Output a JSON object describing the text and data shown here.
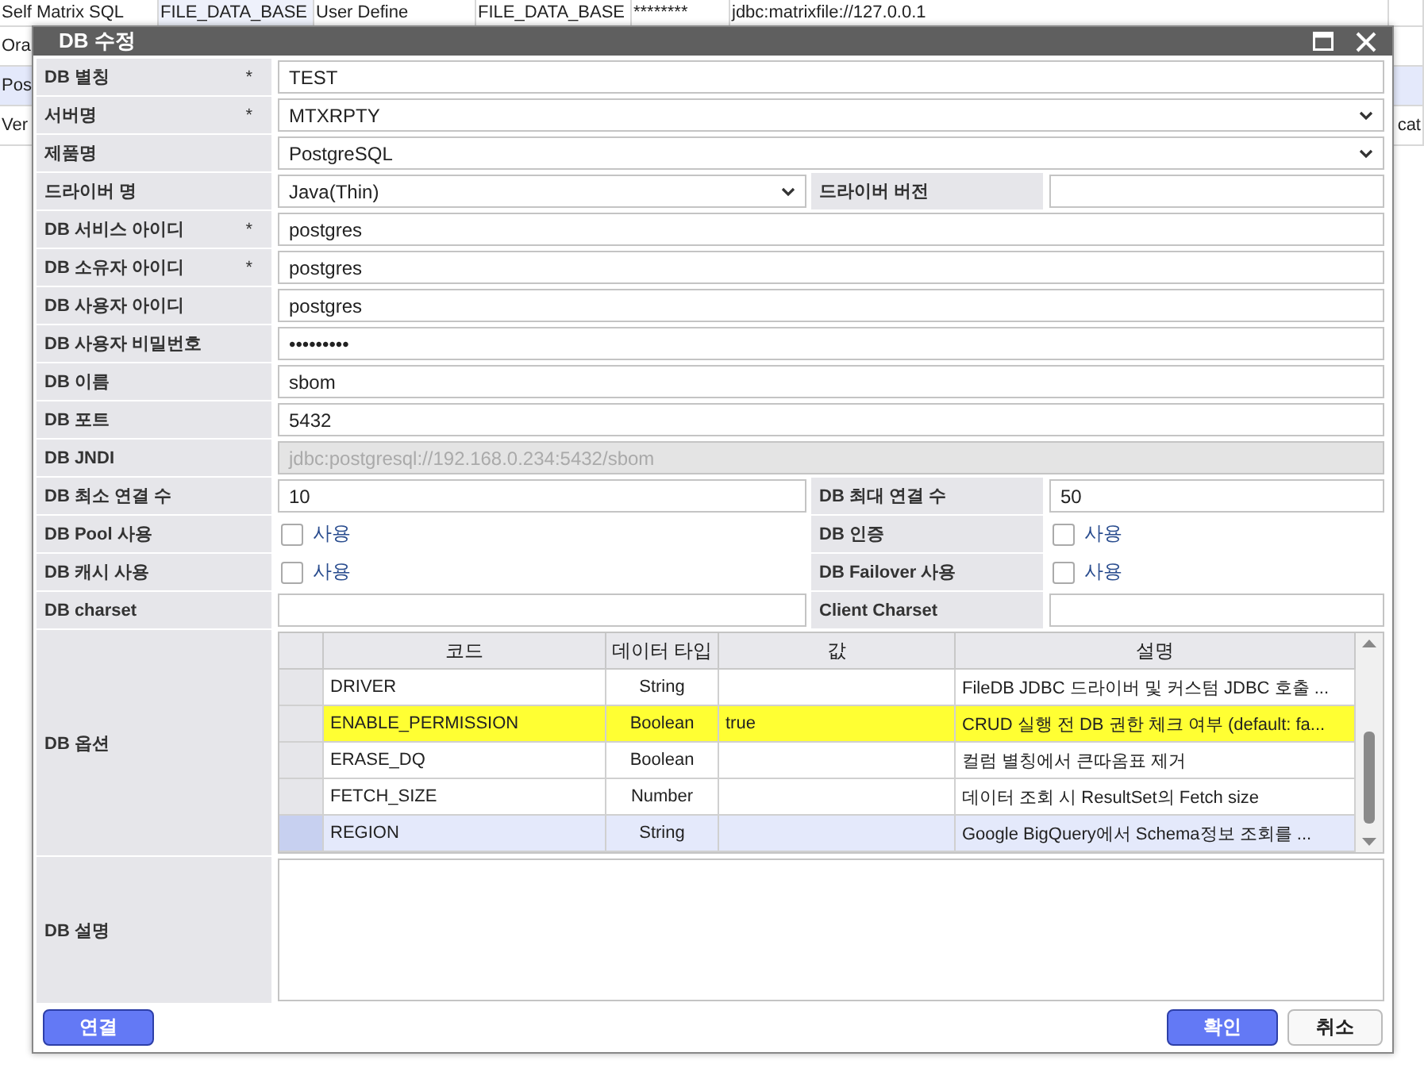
{
  "background_table": {
    "rows": [
      {
        "selected": false,
        "cells": [
          "Self Matrix SQL",
          "FILE_DATA_BASE",
          "User Define",
          "FILE_DATA_BASE",
          "********",
          "jdbc:matrixfile://127.0.0.1"
        ]
      },
      {
        "selected": false,
        "cells": [
          "Ora"
        ]
      },
      {
        "selected": true,
        "cells": [
          "Pos"
        ]
      },
      {
        "selected": false,
        "cells": [
          "Ver"
        ],
        "right_text": "cat"
      }
    ]
  },
  "dialog": {
    "title": "DB 수정",
    "rows": [
      {
        "kind": "input",
        "label": "DB 별칭",
        "marker": "*",
        "value": "TEST"
      },
      {
        "kind": "select",
        "label": "서버명",
        "marker": "*",
        "value": "MTXRPTY"
      },
      {
        "kind": "select",
        "label": "제품명",
        "value": "PostgreSQL"
      },
      {
        "kind": "pair",
        "cells": [
          {
            "kind": "select",
            "label": "드라이버 명",
            "value": "Java(Thin)"
          },
          {
            "kind": "input",
            "label": "드라이버 버전"
          }
        ]
      },
      {
        "kind": "input",
        "label": "DB 서비스 아이디",
        "marker": "*",
        "value": "postgres"
      },
      {
        "kind": "input",
        "label": "DB 소유자 아이디",
        "marker": "*",
        "value": "postgres"
      },
      {
        "kind": "input",
        "label": "DB 사용자 아이디",
        "value": "postgres"
      },
      {
        "kind": "input",
        "label": "DB 사용자 비밀번호",
        "value": "•••••••••"
      },
      {
        "kind": "input",
        "label": "DB 이름",
        "value": "sbom"
      },
      {
        "kind": "input",
        "label": "DB 포트",
        "value": "5432"
      },
      {
        "kind": "disabled",
        "label": "DB JNDI",
        "value": "jdbc:postgresql://192.168.0.234:5432/sbom"
      },
      {
        "kind": "pair",
        "cells": [
          {
            "kind": "input",
            "label": "DB 최소 연결 수",
            "value": "10"
          },
          {
            "kind": "input",
            "label": "DB 최대 연결 수",
            "value": "50"
          }
        ]
      },
      {
        "kind": "pair",
        "cells": [
          {
            "kind": "checkbox",
            "label": "DB Pool 사용",
            "text": "사용",
            "checked": false
          },
          {
            "kind": "checkbox",
            "label": "DB 인증",
            "text": "사용",
            "checked": false
          }
        ]
      },
      {
        "kind": "pair",
        "cells": [
          {
            "kind": "checkbox",
            "label": "DB 캐시 사용",
            "text": "사용",
            "checked": false
          },
          {
            "kind": "checkbox",
            "label": "DB Failover 사용",
            "text": "사용",
            "checked": false
          }
        ]
      },
      {
        "kind": "pair",
        "cells": [
          {
            "kind": "input",
            "label": "DB charset"
          },
          {
            "kind": "input",
            "label": "Client Charset"
          }
        ]
      }
    ],
    "options": {
      "label": "DB 옵션",
      "columns": [
        "코드",
        "데이터 타입",
        "값",
        "설명"
      ],
      "rows": [
        {
          "selected": false,
          "highlighted": false,
          "cells": [
            "DRIVER",
            "String",
            "",
            "FileDB JDBC 드라이버 및 커스텀 JDBC 호출 ..."
          ]
        },
        {
          "selected": false,
          "highlighted": true,
          "cells": [
            "ENABLE_PERMISSION",
            "Boolean",
            "true",
            "CRUD 실행 전 DB 권한 체크 여부 (default: fa..."
          ]
        },
        {
          "selected": false,
          "highlighted": false,
          "cells": [
            "ERASE_DQ",
            "Boolean",
            "",
            "컬럼 별칭에서 큰따옴표 제거"
          ]
        },
        {
          "selected": false,
          "highlighted": false,
          "cells": [
            "FETCH_SIZE",
            "Number",
            "",
            "데이터 조회 시 ResultSet의 Fetch size"
          ]
        },
        {
          "selected": true,
          "highlighted": false,
          "cells": [
            "REGION",
            "String",
            "",
            "Google BigQuery에서 Schema정보 조회를 ..."
          ]
        }
      ]
    },
    "description": {
      "label": "DB 설명"
    },
    "buttons": [
      {
        "label": "연결",
        "kind": "connect"
      },
      {
        "label": "확인",
        "kind": "confirm"
      },
      {
        "label": "취소",
        "kind": "cancel"
      }
    ]
  }
}
